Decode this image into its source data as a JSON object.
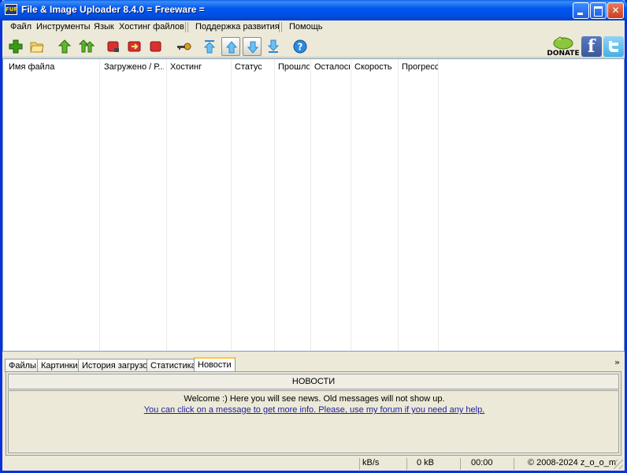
{
  "window": {
    "title": "File & Image Uploader 8.4.0  = Freeware =",
    "icon_label": "FUP"
  },
  "menu": {
    "items": [
      "Файл",
      "Инструменты",
      "Язык",
      "Хостинг файлов",
      "Поддержка развития",
      "Помощь"
    ]
  },
  "toolbar": {
    "icons": [
      "add-icon",
      "open-folder-icon",
      "upload-icon",
      "upload-all-icon",
      "stop-icon",
      "stop-next-icon",
      "stop-all-icon",
      "key-icon",
      "move-top-icon",
      "move-up-icon",
      "move-down-icon",
      "move-bottom-icon",
      "help-icon"
    ],
    "donate_label": "DONATE"
  },
  "columns": [
    "Имя файла",
    "Загружено / Р...",
    "Хостинг",
    "Статус",
    "Прошло",
    "Осталось",
    "Скорость",
    "Прогресс"
  ],
  "tabs": {
    "items": [
      "Файлы",
      "Картинки",
      "История загрузок",
      "Статистика",
      "Новости"
    ],
    "active": "Новости"
  },
  "news": {
    "header": "НОВОСТИ",
    "line1": "Welcome :) Here you will see news. Old messages will not show up.",
    "line2": "You can click on a message to get more info. Please, use my forum if you need any help."
  },
  "status": {
    "speed": "kB/s",
    "size": "0 kB",
    "time": "00:00",
    "copyright": "© 2008-2024 z_o_o_m"
  },
  "colors": {
    "titlebar": "#0058ee",
    "chrome": "#ece9d8",
    "active_tab_accent": "#ffc83c",
    "link": "#1e1e9e"
  }
}
